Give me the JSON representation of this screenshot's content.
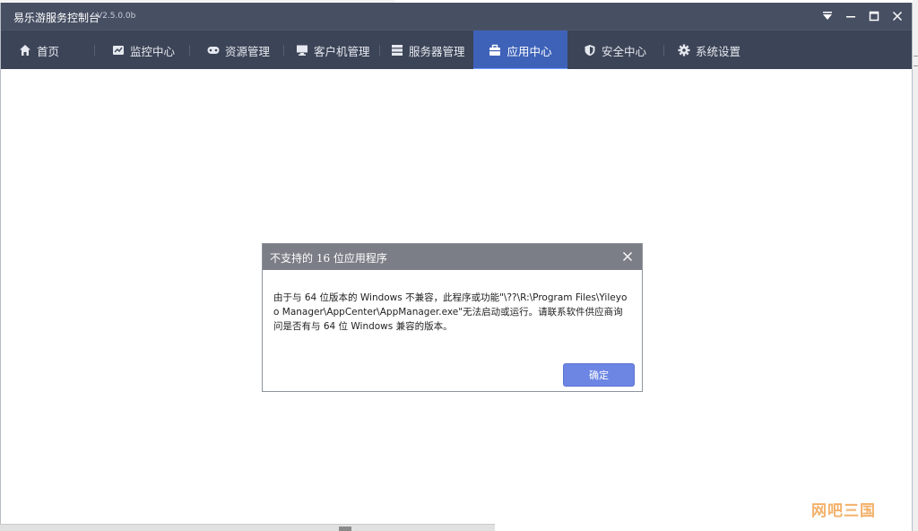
{
  "app": {
    "title": "易乐游服务控制台",
    "version": "V2.5.0.0b"
  },
  "window_controls": [
    {
      "name": "dropdown-icon"
    },
    {
      "name": "minimize-icon"
    },
    {
      "name": "maximize-icon"
    },
    {
      "name": "close-icon"
    }
  ],
  "nav": {
    "items": [
      {
        "label": "首页",
        "icon": "home-icon"
      },
      {
        "label": "监控中心",
        "icon": "monitor-chart-icon"
      },
      {
        "label": "资源管理",
        "icon": "gamepad-icon"
      },
      {
        "label": "客户机管理",
        "icon": "desktop-icon"
      },
      {
        "label": "服务器管理",
        "icon": "server-icon"
      },
      {
        "label": "应用中心",
        "icon": "app-box-icon",
        "active": true
      },
      {
        "label": "安全中心",
        "icon": "shield-icon"
      },
      {
        "label": "系统设置",
        "icon": "gear-icon"
      }
    ]
  },
  "dialog": {
    "title": "不支持的 16 位应用程序",
    "message": "由于与 64 位版本的 Windows 不兼容，此程序或功能\"\\??\\R:\\Program Files\\Yileyoo Manager\\AppCenter\\AppManager.exe\"无法启动或运行。请联系软件供应商询问是否有与 64 位 Windows 兼容的版本。",
    "ok_label": "确定"
  },
  "watermark": "网吧三国",
  "colors": {
    "titlebar": "#474f63",
    "navbar": "#3c4457",
    "nav_active": "#3e62b8",
    "button": "#6d86e4"
  }
}
